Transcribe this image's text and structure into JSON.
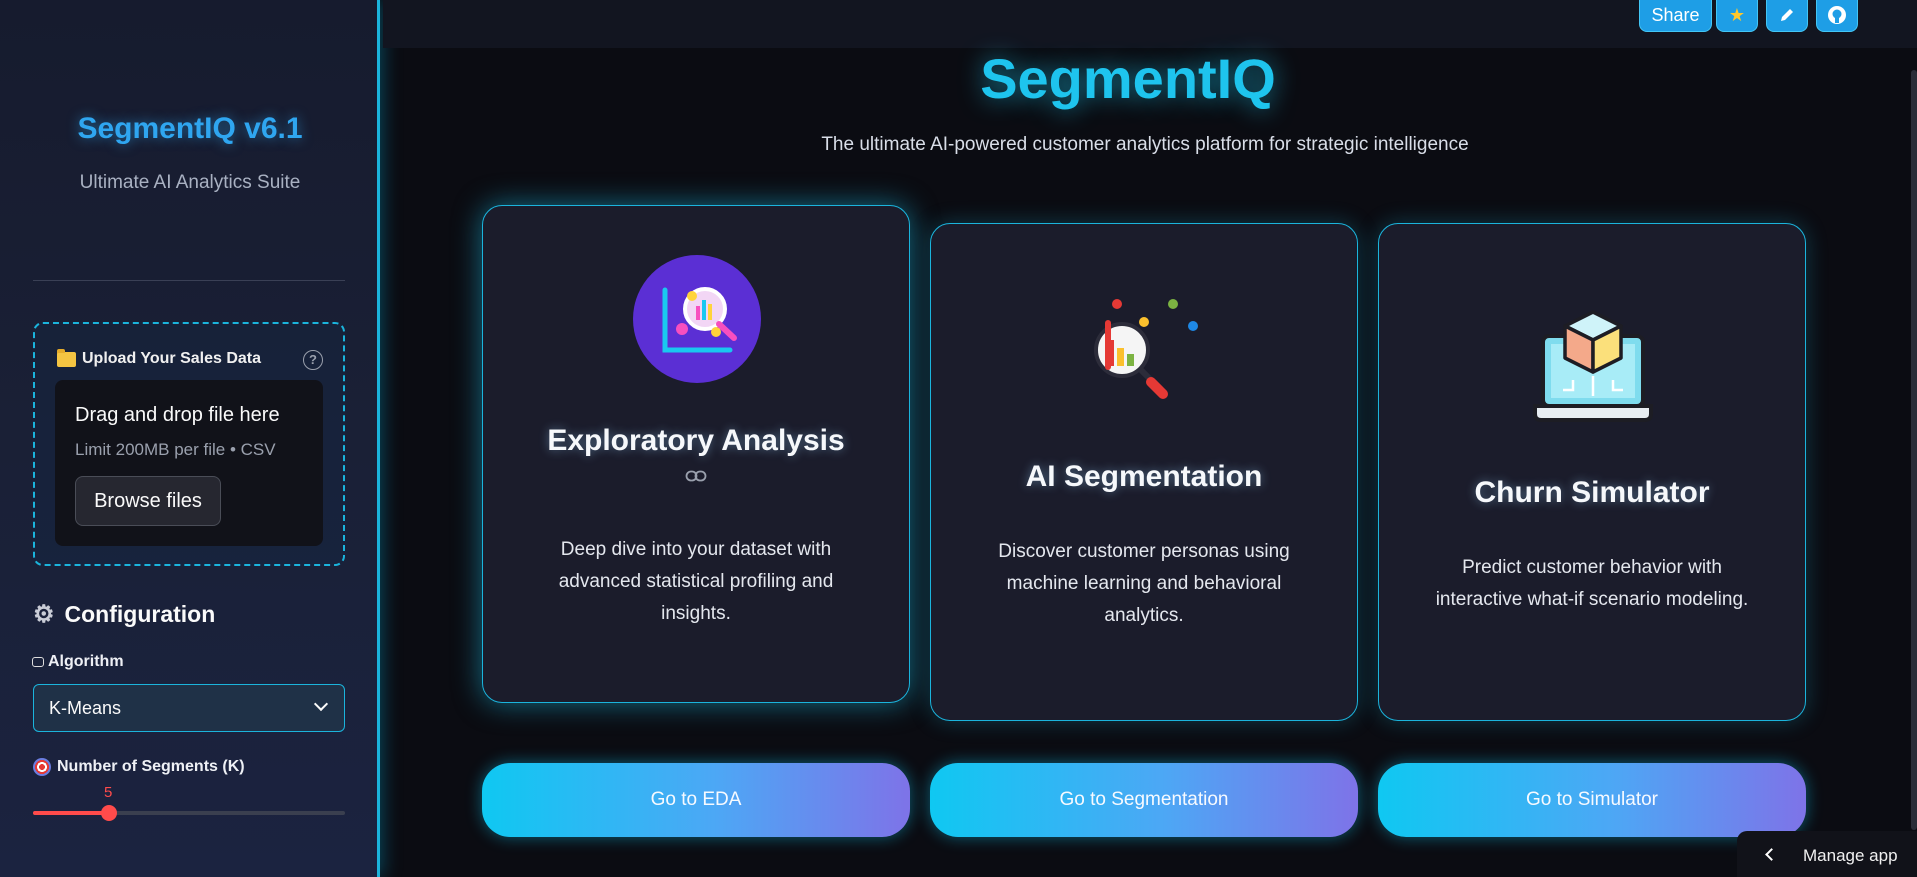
{
  "sidebar": {
    "title": "SegmentIQ v6.1",
    "subtitle": "Ultimate AI Analytics Suite",
    "uploader": {
      "label": "Upload Your Sales Data",
      "dropzone_title": "Drag and drop file here",
      "limit_text": "Limit 200MB per file • CSV",
      "browse_label": "Browse files"
    },
    "config": {
      "heading": "Configuration",
      "algorithm_label": "Algorithm",
      "algorithm_value": "K-Means",
      "segments_label": "Number of Segments (K)",
      "segments_value": "5",
      "segments_fraction": 0.245
    }
  },
  "header": {
    "share_label": "Share",
    "icons": [
      "star-icon",
      "pencil-icon",
      "github-icon"
    ]
  },
  "main": {
    "title": "SegmentIQ",
    "subtitle": "The ultimate AI-powered customer analytics platform for strategic intelligence",
    "cards": [
      {
        "title": "Exploratory Analysis",
        "description": "Deep dive into your dataset with advanced statistical profiling and insights.",
        "button": "Go to EDA",
        "icon": "analytics-magnifier-icon"
      },
      {
        "title": "AI Segmentation",
        "description": "Discover customer personas using machine learning and behavioral analytics.",
        "button": "Go to Segmentation",
        "icon": "segmentation-magnifier-icon"
      },
      {
        "title": "Churn Simulator",
        "description": "Predict customer behavior with interactive what-if scenario modeling.",
        "button": "Go to Simulator",
        "icon": "laptop-cube-icon"
      }
    ]
  },
  "footer": {
    "manage_label": "Manage app"
  },
  "colors": {
    "accent_cyan": "#1ec4ee",
    "border_cyan": "#1bb4dc",
    "slider_red": "#ff4b4b",
    "button_gradient_end": "#7e73e8"
  }
}
